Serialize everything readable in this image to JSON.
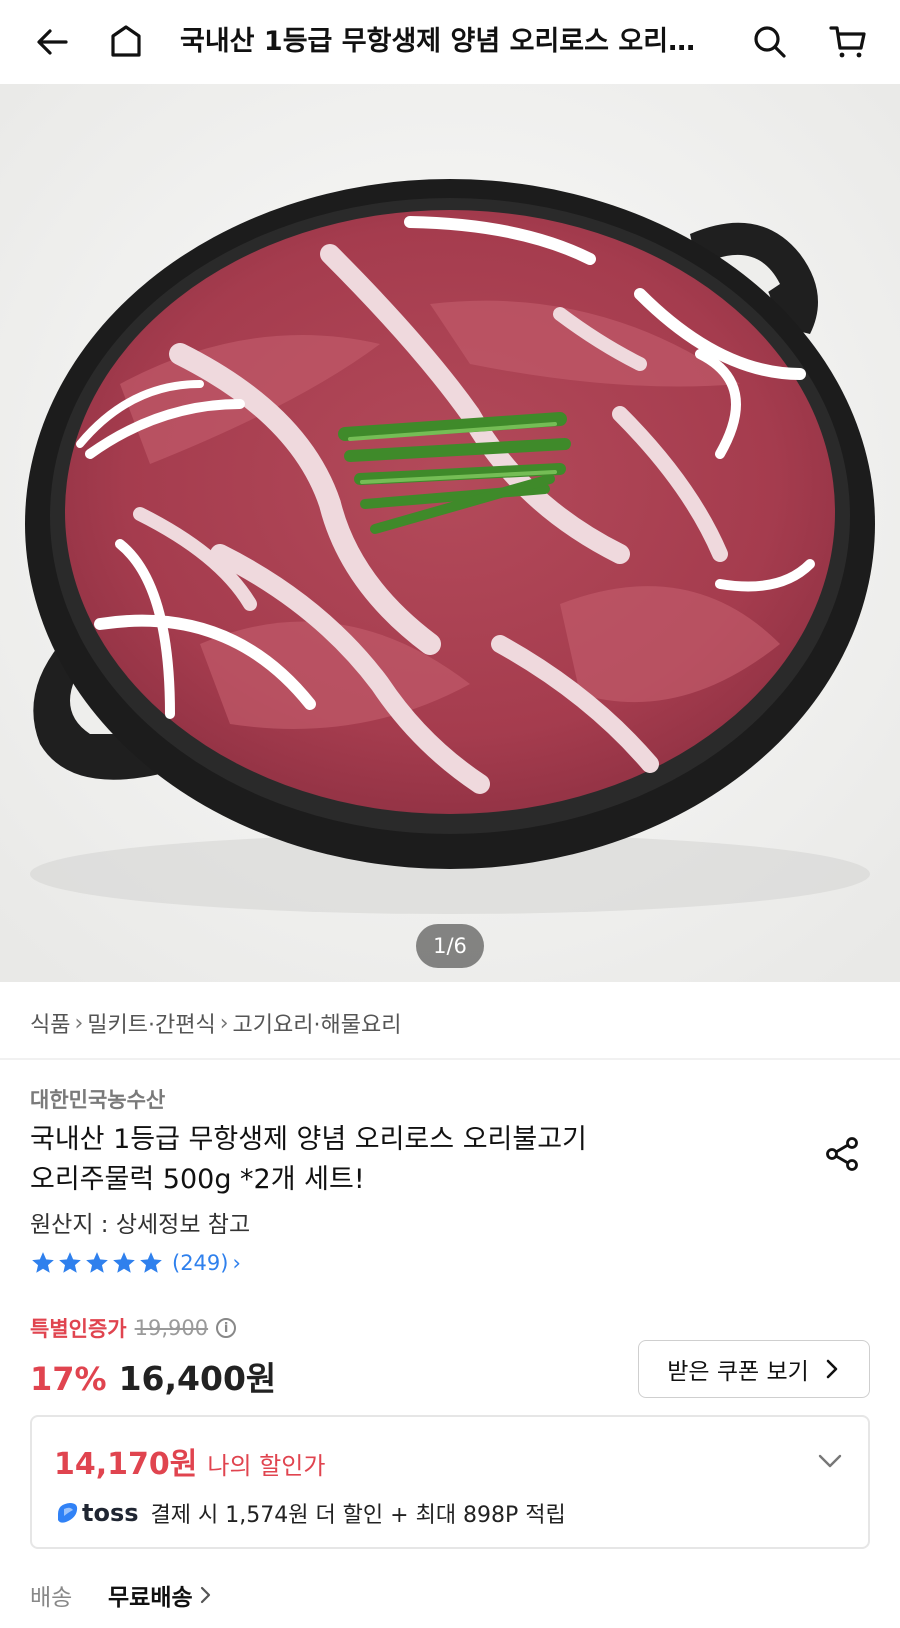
{
  "header": {
    "title": "국내산 1등급 무항생제  양념 오리로스 오리불고기 오리주물럭 500g *2개 세트!"
  },
  "gallery": {
    "current": 1,
    "total": 6,
    "indicator": "1/6"
  },
  "breadcrumb": [
    "식품",
    "밀키트·간편식",
    "고기요리·해물요리"
  ],
  "product": {
    "seller": "대한민국농수산",
    "title_line1": "국내산 1등급 무항생제  양념 오리로스 오리불고기",
    "title_line2": "오리주물럭 500g *2개 세트!",
    "origin": "원산지 : 상세정보 참고",
    "rating_stars": 5,
    "review_count": "(249)"
  },
  "pricing": {
    "special_label": "특별인증가",
    "original_price": "19,900",
    "discount_pct": "17%",
    "sale_price": "16,400원",
    "coupon_button": "받은 쿠폰 보기"
  },
  "my_discount": {
    "price": "14,170원",
    "label": "나의 할인가",
    "toss_brand": "toss",
    "toss_benefit": "결제 시 1,574원 더 할인 + 최대 898P 적립"
  },
  "shipping": {
    "label": "배송",
    "value": "무료배송"
  },
  "colors": {
    "accent_red": "#e0444f",
    "star_blue": "#2f80ed",
    "toss_blue": "#3182f6"
  },
  "icons": [
    "back-arrow-icon",
    "home-icon",
    "search-icon",
    "cart-icon",
    "share-icon",
    "star-icon",
    "info-icon",
    "chevron-down-icon",
    "chevron-right-icon",
    "toss-logo-icon"
  ]
}
